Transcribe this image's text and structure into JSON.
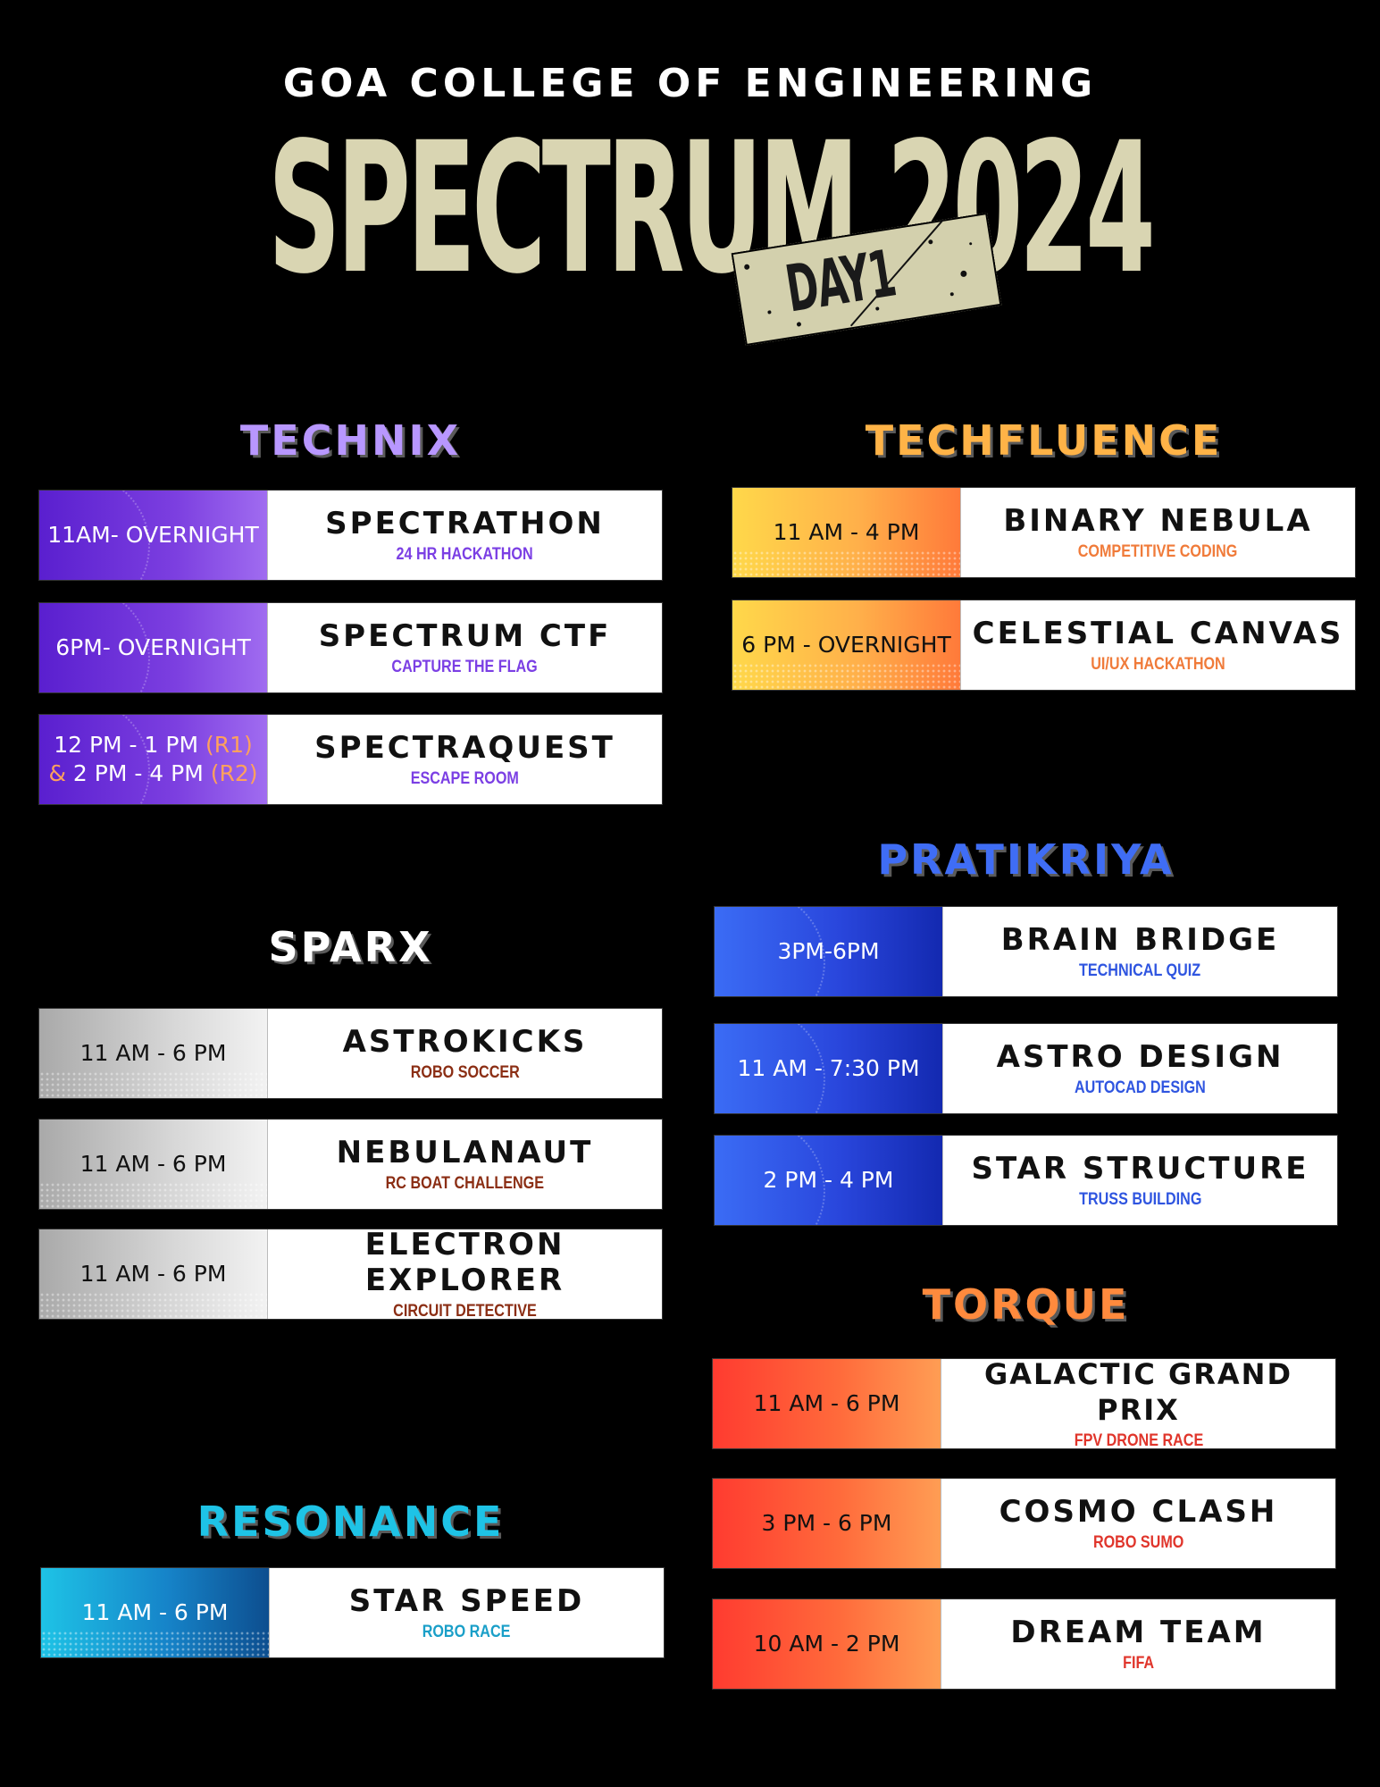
{
  "header": {
    "college": "GOA COLLEGE OF ENGINEERING",
    "title": "SPECTRUM 2024",
    "day": "DAY1"
  },
  "colors": {
    "title": "#d9d5b2",
    "technix": "#b897ff",
    "techfluence": "#ffb347",
    "sparx": "#ffffff",
    "pratikriya": "#3f6df5",
    "torque": "#ff8a3d",
    "resonance": "#1ec3e6"
  },
  "sections": {
    "technix": {
      "heading": "TECHNIX",
      "events": [
        {
          "time": "11AM- OVERNIGHT",
          "name": "SPECTRATHON",
          "sub": "24 HR HACKATHON"
        },
        {
          "time": "6PM- OVERNIGHT",
          "name": "SPECTRUM CTF",
          "sub": "CAPTURE THE FLAG"
        },
        {
          "time_line1": "12 PM - 1 PM",
          "time_r1": "(R1)",
          "time_amp": "&",
          "time_line2": "2 PM - 4 PM",
          "time_r2": "(R2)",
          "name": "SPECTRAQUEST",
          "sub": "ESCAPE ROOM"
        }
      ]
    },
    "techfluence": {
      "heading": "TECHFLUENCE",
      "events": [
        {
          "time": "11 AM - 4 PM",
          "name": "BINARY NEBULA",
          "sub": "COMPETITIVE CODING"
        },
        {
          "time": "6 PM - OVERNIGHT",
          "name": "CELESTIAL CANVAS",
          "sub": "UI/UX HACKATHON"
        }
      ]
    },
    "sparx": {
      "heading": "SPARX",
      "events": [
        {
          "time": "11 AM - 6 PM",
          "name": "ASTROKICKS",
          "sub": "ROBO SOCCER"
        },
        {
          "time": "11 AM - 6 PM",
          "name": "NEBULANAUT",
          "sub": "RC BOAT CHALLENGE"
        },
        {
          "time": "11 AM - 6 PM",
          "name": "ELECTRON EXPLORER",
          "sub": "CIRCUIT DETECTIVE"
        }
      ]
    },
    "pratikriya": {
      "heading": "PRATIKRIYA",
      "events": [
        {
          "time": "3PM-6PM",
          "name": "BRAIN BRIDGE",
          "sub": "TECHNICAL QUIZ"
        },
        {
          "time": "11  AM - 7:30 PM",
          "name": "ASTRO DESIGN",
          "sub": "AUTOCAD DESIGN"
        },
        {
          "time": "2 PM - 4 PM",
          "name": "STAR STRUCTURE",
          "sub": "TRUSS BUILDING"
        }
      ]
    },
    "torque": {
      "heading": "TORQUE",
      "events": [
        {
          "time": "11 AM - 6 PM",
          "name": "GALACTIC GRAND PRIX",
          "sub": "FPV DRONE RACE"
        },
        {
          "time": "3 PM - 6 PM",
          "name": "COSMO CLASH",
          "sub": "ROBO SUMO"
        },
        {
          "time": "10 AM - 2 PM",
          "name": "DREAM TEAM",
          "sub": "FIFA"
        }
      ]
    },
    "resonance": {
      "heading": "RESONANCE",
      "events": [
        {
          "time": "11 AM - 6 PM",
          "name": "STAR SPEED",
          "sub": "ROBO RACE"
        }
      ]
    }
  }
}
